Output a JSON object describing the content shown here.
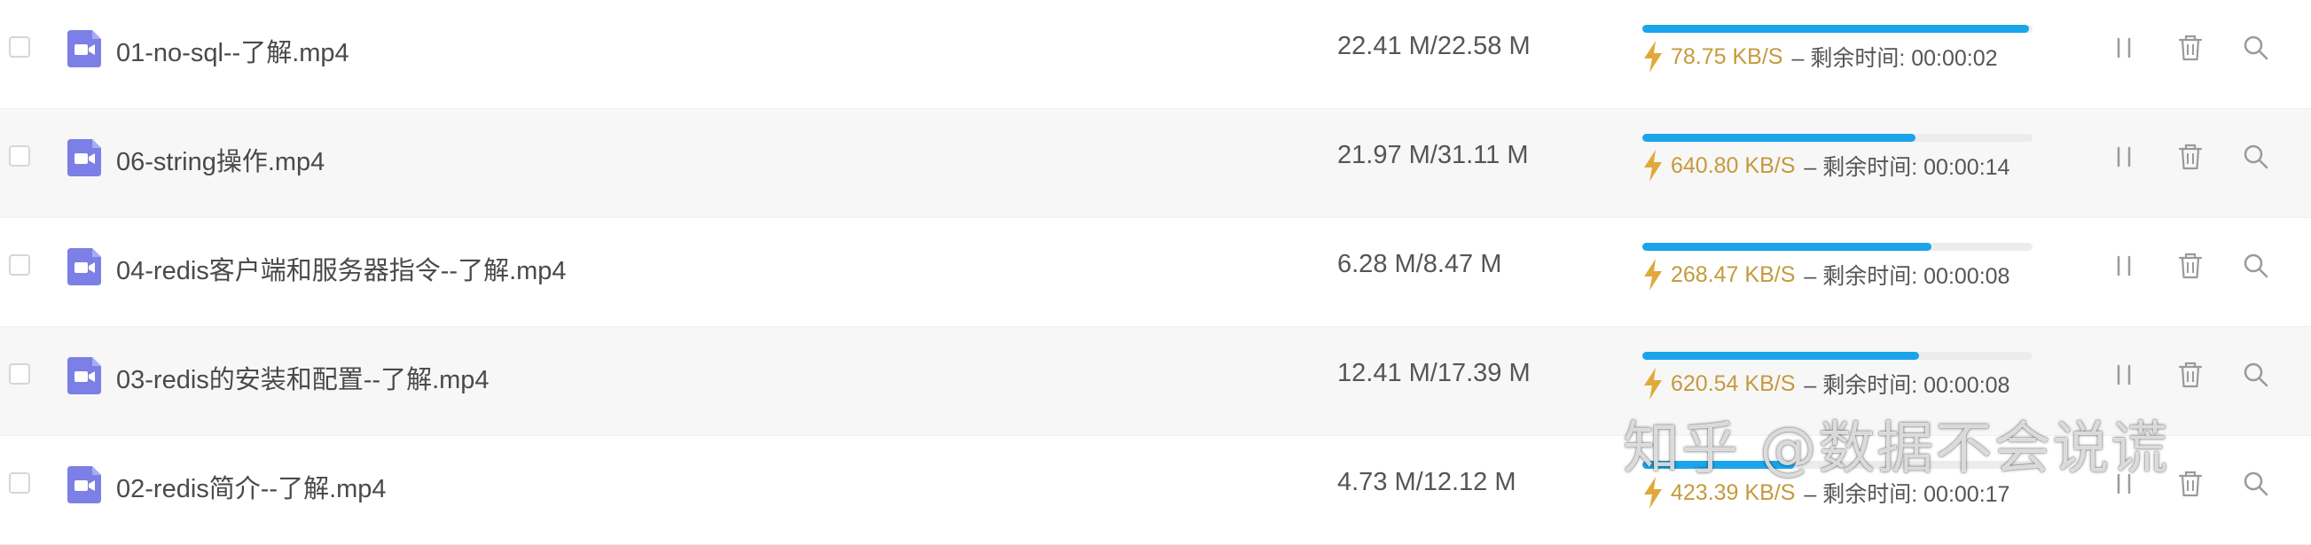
{
  "downloads": [
    {
      "name": "01-no-sql--了解.mp4",
      "size": "22.41 M/22.58 M",
      "progress": 0.99,
      "speed": "78.75 KB/S",
      "remaining": "– 剩余时间: 00:00:02"
    },
    {
      "name": "06-string操作.mp4",
      "size": "21.97 M/31.11 M",
      "progress": 0.7,
      "speed": "640.80 KB/S",
      "remaining": "– 剩余时间: 00:00:14"
    },
    {
      "name": "04-redis客户端和服务器指令--了解.mp4",
      "size": "6.28 M/8.47 M",
      "progress": 0.74,
      "speed": "268.47 KB/S",
      "remaining": "– 剩余时间: 00:00:08"
    },
    {
      "name": "03-redis的安装和配置--了解.mp4",
      "size": "12.41 M/17.39 M",
      "progress": 0.71,
      "speed": "620.54 KB/S",
      "remaining": "– 剩余时间: 00:00:08"
    },
    {
      "name": "02-redis简介--了解.mp4",
      "size": "4.73 M/12.12 M",
      "progress": 0.39,
      "speed": "423.39 KB/S",
      "remaining": "– 剩余时间: 00:00:17"
    }
  ],
  "icons": {
    "file": "video-file-icon",
    "speed": "lightning-icon",
    "pause": "pause-icon",
    "delete": "trash-icon",
    "search": "search-icon"
  },
  "colors": {
    "progress": "#1aa4ea",
    "speed": "#c59a3c",
    "file_icon": "#7b7fe6"
  },
  "watermark": "知乎 @数据不会说谎"
}
